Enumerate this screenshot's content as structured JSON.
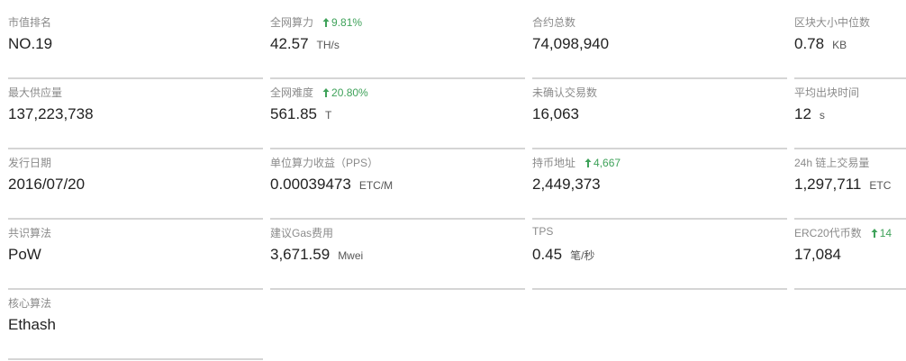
{
  "stats": {
    "rank": {
      "label": "市值排名",
      "value": "NO.19"
    },
    "hashrate": {
      "label": "全网算力",
      "change": "9.81%",
      "value": "42.57",
      "unit": "TH/s"
    },
    "contracts": {
      "label": "合约总数",
      "value": "74,098,940"
    },
    "block_size": {
      "label": "区块大小中位数",
      "value": "0.78",
      "unit": "KB"
    },
    "max_supply": {
      "label": "最大供应量",
      "value": "137,223,738"
    },
    "difficulty": {
      "label": "全网难度",
      "change": "20.80%",
      "value": "561.85",
      "unit": "T"
    },
    "pending_tx": {
      "label": "未确认交易数",
      "value": "16,063"
    },
    "block_time": {
      "label": "平均出块时间",
      "value": "12",
      "unit": "s"
    },
    "issue_date": {
      "label": "发行日期",
      "value": "2016/07/20"
    },
    "pps": {
      "label": "单位算力收益（PPS）",
      "value": "0.00039473",
      "unit": "ETC/M"
    },
    "holders": {
      "label": "持币地址",
      "change": "4,667",
      "value": "2,449,373"
    },
    "volume_24h": {
      "label": "24h 链上交易量",
      "value": "1,297,711",
      "unit": "ETC"
    },
    "consensus": {
      "label": "共识算法",
      "value": "PoW"
    },
    "gas_fee": {
      "label": "建议Gas费用",
      "value": "3,671.59",
      "unit": "Mwei"
    },
    "tps": {
      "label": "TPS",
      "value": "0.45",
      "unit": "笔/秒"
    },
    "erc20": {
      "label": "ERC20代币数",
      "change": "14",
      "value": "17,084"
    },
    "core_algo": {
      "label": "核心算法",
      "value": "Ethash"
    }
  },
  "colors": {
    "up": "#3fa25a",
    "label": "#8b8b8b",
    "value": "#222222",
    "divider": "#d5d5d5"
  },
  "icons": {
    "change": "arrow-up-icon"
  }
}
